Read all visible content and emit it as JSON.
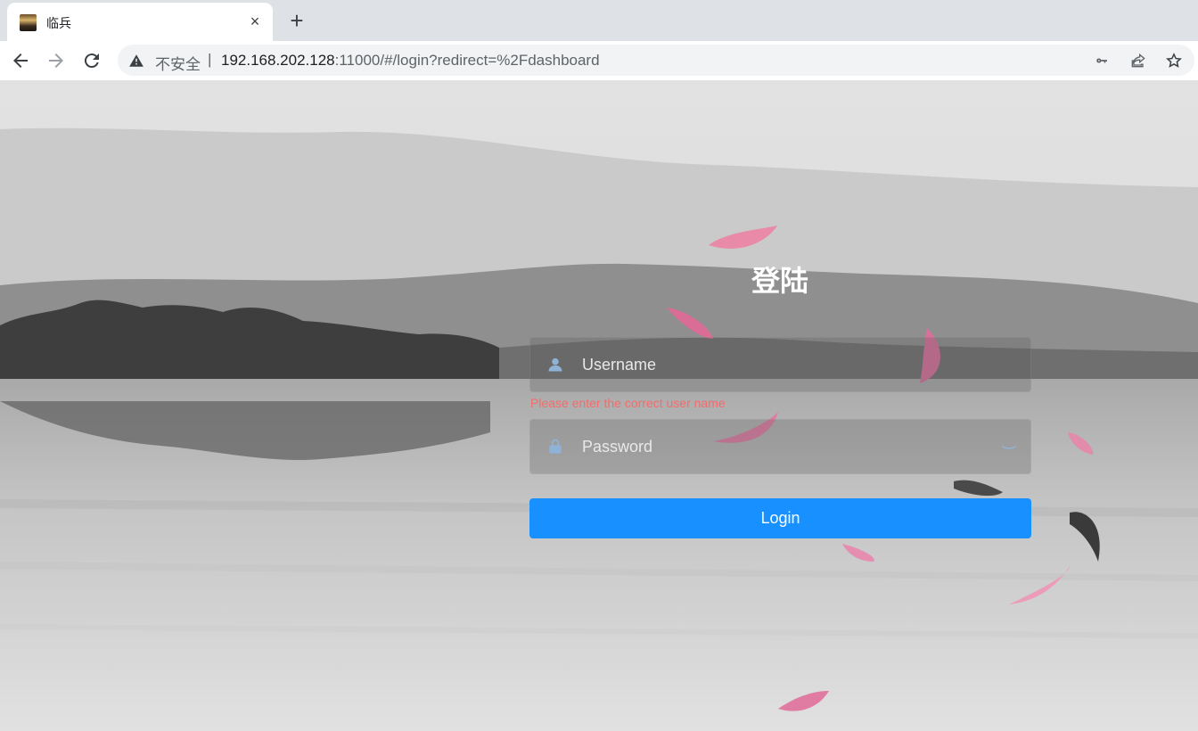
{
  "browser": {
    "tab": {
      "title": "临兵",
      "favicon": "tab-favicon-icon",
      "close": "×"
    },
    "new_tab": "+",
    "security_label": "不安全",
    "separator": "|",
    "url_host": "192.168.202.128",
    "url_rest": ":11000/#/login?redirect=%2Fdashboard"
  },
  "login": {
    "title": "登陆",
    "username_placeholder": "Username",
    "username_error": "Please enter the correct user name",
    "password_placeholder": "Password",
    "button_label": "Login",
    "button_color": "#1890ff",
    "error_color": "#f56c6c"
  }
}
